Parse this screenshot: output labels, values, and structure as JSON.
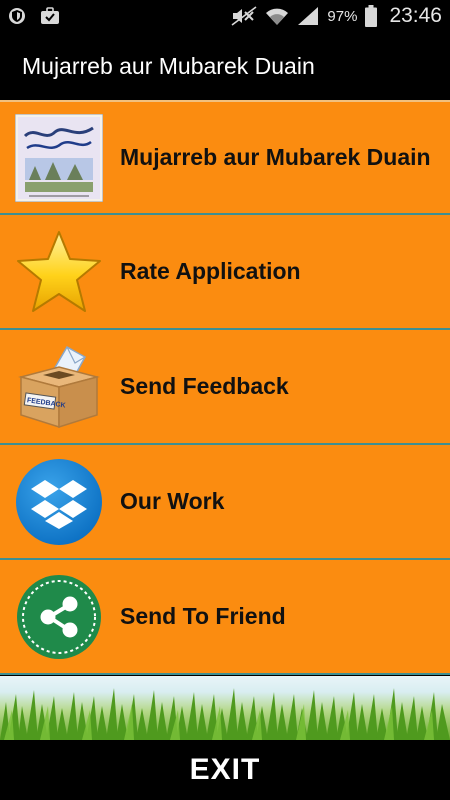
{
  "status_bar": {
    "battery_percent": "97%",
    "time": "23:46",
    "icons": [
      "shield-icon",
      "briefcase-icon",
      "mute-icon",
      "wifi-icon",
      "signal-icon",
      "battery-icon"
    ]
  },
  "app_bar": {
    "title": "Mujarreb aur Mubarek Duain"
  },
  "menu": {
    "items": [
      {
        "label": "Mujarreb aur Mubarek Duain",
        "icon": "book-cover-icon"
      },
      {
        "label": "Rate Application",
        "icon": "star-icon"
      },
      {
        "label": "Send Feedback",
        "icon": "feedback-box-icon"
      },
      {
        "label": "Our Work",
        "icon": "dropbox-icon"
      },
      {
        "label": "Send To Friend",
        "icon": "share-icon"
      }
    ],
    "feedback_box_text": "FEEDBACK"
  },
  "colors": {
    "menu_background": "#fb8c10",
    "divider": "#3e8f92",
    "bar_background": "#000000"
  },
  "footer": {
    "exit_label": "EXIT"
  }
}
